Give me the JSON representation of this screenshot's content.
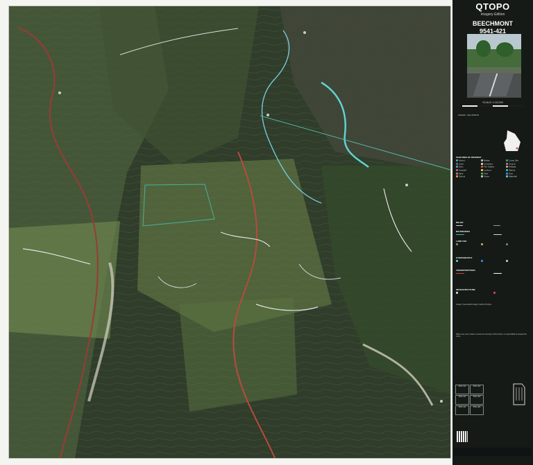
{
  "header": {
    "brand": "QTOPO",
    "edition": "Imagery Edition",
    "sheet_name": "BEECHMONT",
    "sheet_number": "9541-421"
  },
  "scale": {
    "text": "SCALE 1:15,000"
  },
  "legend": {
    "feature_title": "FEATURES OF INTEREST",
    "relief_title": "RELIEF",
    "boundaries_title": "BOUNDARIES",
    "land_use_title": "LAND USE",
    "hydrography_title": "HYDROGRAPHY",
    "transportation_title": "TRANSPORTATION",
    "infrastructure_title": "INFRASTRUCTURE"
  },
  "legend_items": [
    "Airport",
    "Bridge",
    "Camp Site",
    "Cave",
    "Cemetery",
    "Church",
    "Dam",
    "Fire Station",
    "Helipad",
    "Hospital",
    "Lookout",
    "Marina",
    "Mine",
    "Park",
    "Pool",
    "School",
    "Tower",
    "Waterfall"
  ],
  "notes": {
    "imagery": "Imagery: Queensland Imagery Capture Program.",
    "disclaimer": "While every care is taken to ensure the accuracy of this product, no responsibility is accepted for errors."
  },
  "adjoining_sheets": [
    "9541-412",
    "9541-422",
    "9541-413",
    "9541-423",
    "9541-414",
    "9541-424"
  ]
}
